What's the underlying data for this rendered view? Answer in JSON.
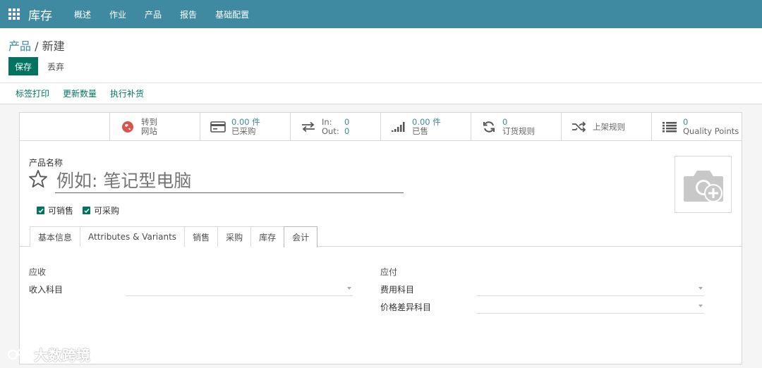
{
  "navbar": {
    "brand": "库存",
    "menu": [
      "概述",
      "作业",
      "产品",
      "报告",
      "基础配置"
    ]
  },
  "breadcrumb": {
    "parent": "产品",
    "separator": " / ",
    "current": "新建"
  },
  "buttons": {
    "save": "保存",
    "discard": "丢弃"
  },
  "actions": [
    "标签打印",
    "更新数量",
    "执行补货"
  ],
  "smart_buttons": {
    "website": {
      "line1": "转到",
      "line2": "网站"
    },
    "purchased": {
      "value": "0.00 件",
      "label": "已采购"
    },
    "inout": {
      "in_label": "In:",
      "in_value": "0",
      "out_label": "Out:",
      "out_value": "0"
    },
    "sold": {
      "value": "0.00 件",
      "label": "已售"
    },
    "reorder": {
      "value": "0",
      "label": "订货规则"
    },
    "putaway": {
      "label": "上架规则"
    },
    "quality": {
      "value": "0",
      "label": "Quality Points"
    }
  },
  "form": {
    "name_label": "产品名称",
    "name_placeholder": "例如: 笔记型电脑",
    "can_be_sold": "可销售",
    "can_be_purchased": "可采购"
  },
  "tabs": [
    "基本信息",
    "Attributes & Variants",
    "销售",
    "采购",
    "库存",
    "会计"
  ],
  "accounting": {
    "receivable_title": "应收",
    "income_account": "收入科目",
    "payable_title": "应付",
    "expense_account": "费用科目",
    "price_diff_account": "价格差异科目"
  },
  "watermark": "大数跨境",
  "colors": {
    "navbar": "#3f8aa0",
    "primary": "#00745f",
    "link": "#3f8aa0"
  }
}
